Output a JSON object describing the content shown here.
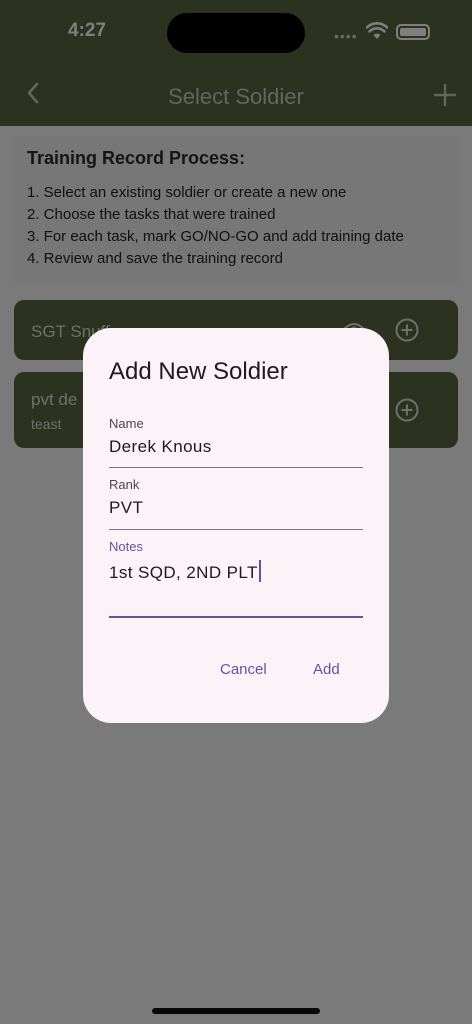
{
  "status_bar": {
    "time": "4:27",
    "signal": "••••"
  },
  "app_bar": {
    "title": "Select Soldier"
  },
  "instructions": {
    "title": "Training Record Process:",
    "steps": [
      "1. Select an existing soldier or create a new one",
      "2. Choose the tasks that were trained",
      "3. For each task, mark GO/NO-GO and add training date",
      "4. Review and save the training record"
    ]
  },
  "soldiers": [
    {
      "name": "SGT Snuff",
      "notes": ""
    },
    {
      "name": "pvt de",
      "notes": "teast"
    }
  ],
  "dialog": {
    "title": "Add New Soldier",
    "name_label": "Name",
    "name_value": "Derek Knous",
    "rank_label": "Rank",
    "rank_value": "PVT",
    "notes_label": "Notes",
    "notes_value": "1st SQD, 2ND PLT",
    "cancel_label": "Cancel",
    "add_label": "Add"
  },
  "colors": {
    "app_bar": "#56643f",
    "accent": "#6750a4",
    "dialog_bg": "#fcf3f8"
  }
}
